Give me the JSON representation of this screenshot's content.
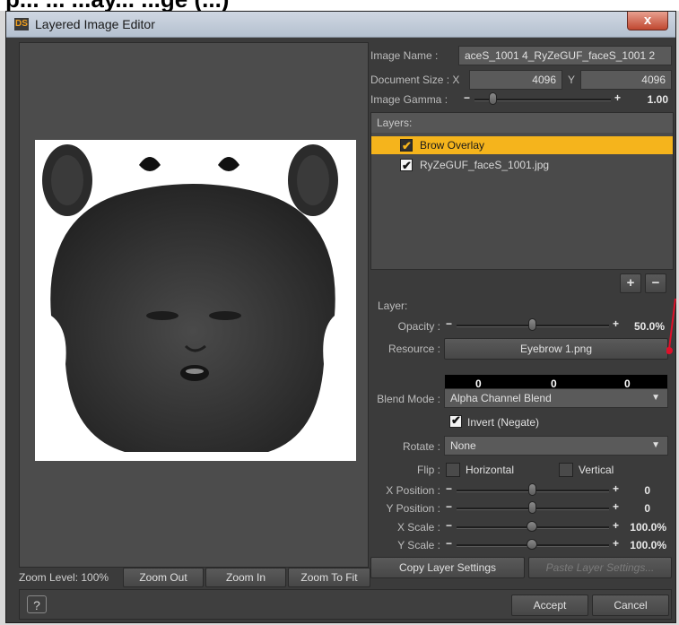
{
  "heading_partial": "p... ... ...ay... ...ge (...)",
  "window": {
    "title": "Layered Image Editor",
    "close_label": "x",
    "logo": "DS"
  },
  "image_info": {
    "image_name_label": "Image Name :",
    "image_name_value": "aceS_1001 4_RyZeGUF_faceS_1001 2",
    "doc_size_label": "Document Size : X",
    "doc_x": "4096",
    "doc_y_label": "Y",
    "doc_y": "4096",
    "gamma_label": "Image Gamma :",
    "gamma_value": "1.00"
  },
  "layers": {
    "header": "Layers:",
    "items": [
      {
        "label": "Brow Overlay",
        "checked": true,
        "selected": true
      },
      {
        "label": "RyZeGUF_faceS_1001.jpg",
        "checked": true,
        "selected": false
      }
    ],
    "add_label": "+",
    "remove_label": "−"
  },
  "layer_props": {
    "section_label": "Layer:",
    "opacity_label": "Opacity :",
    "opacity_value": "50.0%",
    "opacity_fraction": 0.5,
    "resource_label": "Resource :",
    "resource_value": "Eyebrow 1.png",
    "color_r": "0",
    "color_g": "0",
    "color_b": "0",
    "blend_label": "Blend Mode :",
    "blend_value": "Alpha Channel Blend",
    "invert_label": "Invert (Negate)",
    "rotate_label": "Rotate :",
    "rotate_value": "None",
    "flip_label": "Flip :",
    "flip_h_label": "Horizontal",
    "flip_v_label": "Vertical",
    "xpos_label": "X Position :",
    "xpos_value": "0",
    "ypos_label": "Y Position :",
    "ypos_value": "0",
    "xscale_label": "X Scale :",
    "xscale_value": "100.0%",
    "yscale_label": "Y Scale :",
    "yscale_value": "100.0%",
    "copy_label": "Copy Layer Settings",
    "paste_label": "Paste Layer Settings..."
  },
  "zoom": {
    "level_label": "Zoom Level: 100%",
    "zoom_out": "Zoom Out",
    "zoom_in": "Zoom In",
    "zoom_fit": "Zoom To Fit"
  },
  "footer": {
    "help": "?",
    "accept": "Accept",
    "cancel": "Cancel"
  },
  "colors": {
    "accent": "#f5b41c",
    "panel": "#3b3b3b",
    "annotation": "#e0102a"
  },
  "icons": [
    "ds-logo-icon",
    "close-icon",
    "checkbox-icon",
    "help-icon",
    "dropdown-arrow-icon",
    "red-arrow-annotation"
  ]
}
